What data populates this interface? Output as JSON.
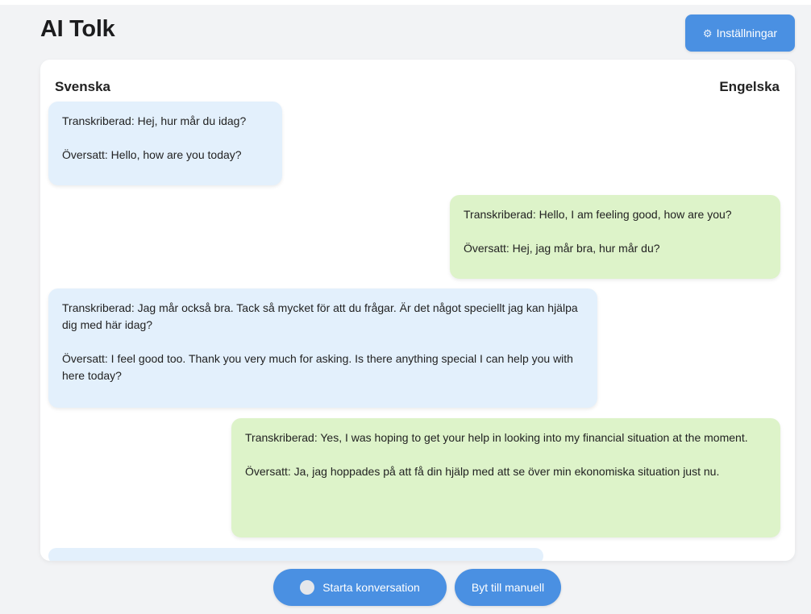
{
  "header": {
    "title": "AI Tolk",
    "settings_label": "Inställningar",
    "settings_icon": "gear-icon"
  },
  "languages": {
    "source": "Svenska",
    "target": "Engelska"
  },
  "messages": [
    {
      "side": "left",
      "transcribed": "Transkriberad: Hej, hur mår du idag?",
      "translated": "Översatt: Hello, how are you today?"
    },
    {
      "side": "right",
      "transcribed": "Transkriberad: Hello, I am feeling good, how are you?",
      "translated": "Översatt: Hej, jag mår bra, hur mår du?"
    },
    {
      "side": "left",
      "transcribed": "Transkriberad: Jag mår också bra. Tack så mycket för att du frågar. Är det något speciellt jag kan hjälpa dig med här idag?",
      "translated": "Översatt: I feel good too. Thank you very much for asking. Is there anything special I can help you with here today?"
    },
    {
      "side": "right",
      "transcribed": "Transkriberad: Yes, I was hoping to get your help in looking into my financial situation at the moment.",
      "translated": "Översatt: Ja, jag hoppades på att få din hjälp med att se över min ekonomiska situation just nu."
    }
  ],
  "controls": {
    "start_label": "Starta konversation",
    "manual_label": "Byt till manuell"
  },
  "colors": {
    "accent": "#4a90e2",
    "left_bubble": "#e3f0fc",
    "right_bubble": "#ddf3c9"
  }
}
